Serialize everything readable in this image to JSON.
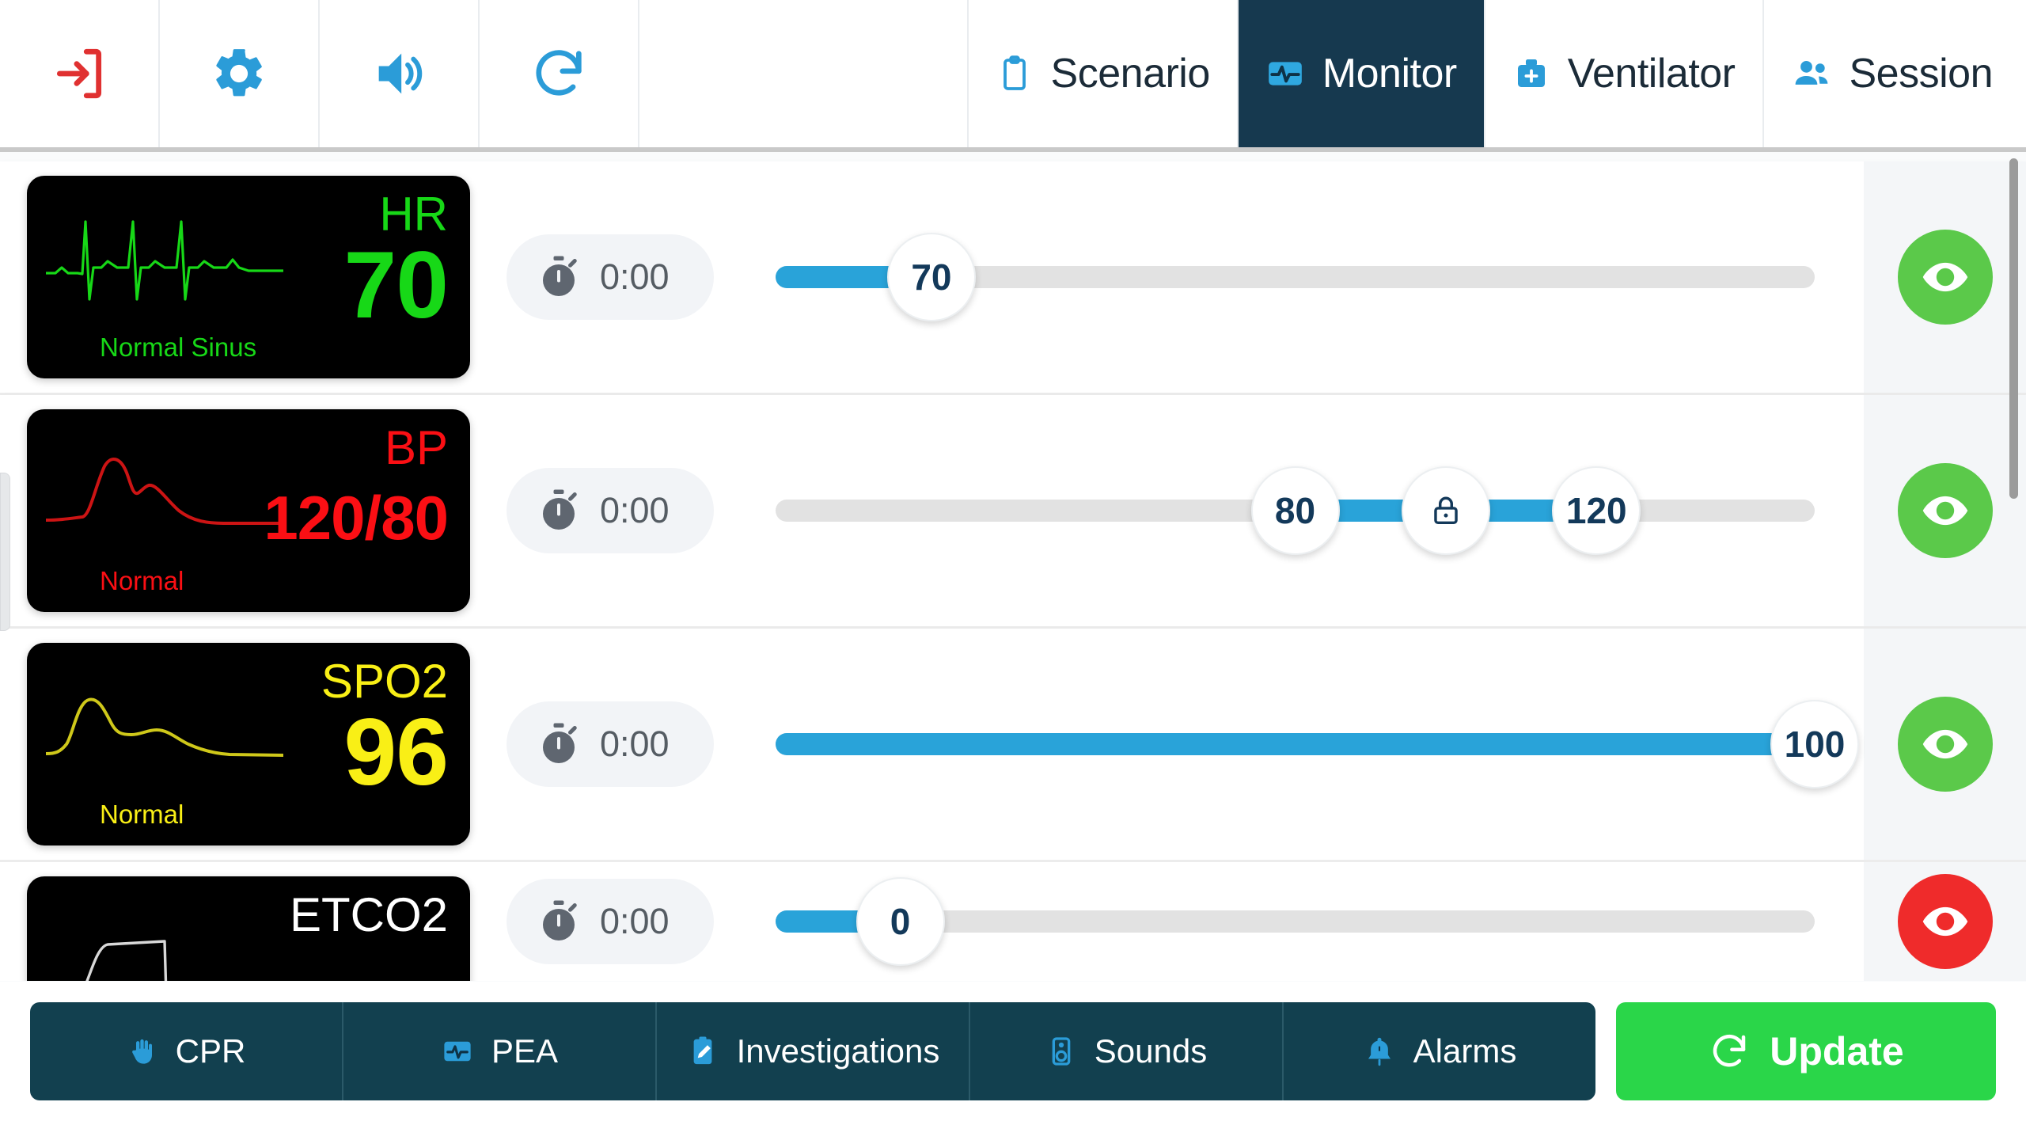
{
  "header": {
    "icon_buttons": [
      {
        "name": "exit-icon",
        "color": "#e03131"
      },
      {
        "name": "settings-gear-icon",
        "color": "#2b9cd8"
      },
      {
        "name": "volume-icon",
        "color": "#2b9cd8"
      },
      {
        "name": "refresh-icon",
        "color": "#2b9cd8"
      }
    ],
    "tabs": [
      {
        "label": "Scenario",
        "icon": "clipboard-icon",
        "active": false
      },
      {
        "label": "Monitor",
        "icon": "monitor-waveform-icon",
        "active": true
      },
      {
        "label": "Ventilator",
        "icon": "medical-bag-icon",
        "active": false
      },
      {
        "label": "Session",
        "icon": "people-icon",
        "active": false
      }
    ]
  },
  "vitals": [
    {
      "label": "HR",
      "value": "70",
      "status": "Normal Sinus",
      "color": "#17d817",
      "waveform": "ecg",
      "timer": "0:00",
      "slider": {
        "type": "single",
        "value": 70,
        "min": 0,
        "max": 250,
        "fill_pct": 15
      },
      "visibility": {
        "icon": "eye-icon",
        "state": "visible",
        "color": "#5bc94a"
      }
    },
    {
      "label": "BP",
      "value": "120/80",
      "status": "Normal",
      "color": "#fb0f14",
      "waveform": "arterial",
      "timer": "0:00",
      "slider": {
        "type": "range",
        "low": 80,
        "high": 120,
        "lock": true,
        "min": 0,
        "max": 250,
        "low_pct": 50,
        "high_pct": 79
      },
      "visibility": {
        "icon": "eye-icon",
        "state": "visible",
        "color": "#5bc94a"
      }
    },
    {
      "label": "SPO2",
      "value": "96",
      "status": "Normal",
      "color": "#f9ef16",
      "waveform": "pleth",
      "timer": "0:00",
      "slider": {
        "type": "single",
        "value": 100,
        "min": 0,
        "max": 100,
        "fill_pct": 100
      },
      "visibility": {
        "icon": "eye-icon",
        "state": "visible",
        "color": "#5bc94a"
      }
    },
    {
      "label": "ETCO2",
      "value": "",
      "status": "",
      "color": "#ffffff",
      "waveform": "capno",
      "timer": "0:00",
      "slider": {
        "type": "single",
        "value": 0,
        "min": 0,
        "max": 100,
        "fill_pct": 12
      },
      "visibility": {
        "icon": "eye-slash-icon",
        "state": "hidden",
        "color": "#ef2b2b"
      }
    }
  ],
  "footer": {
    "buttons": [
      {
        "label": "CPR",
        "icon": "hand-icon"
      },
      {
        "label": "PEA",
        "icon": "monitor-waveform-icon"
      },
      {
        "label": "Investigations",
        "icon": "clipboard-pencil-icon"
      },
      {
        "label": "Sounds",
        "icon": "speaker-icon"
      },
      {
        "label": "Alarms",
        "icon": "bell-icon"
      }
    ],
    "update": {
      "label": "Update",
      "icon": "refresh-icon",
      "color": "#2ad649"
    }
  },
  "colors": {
    "accent_blue": "#29a3d9",
    "nav_active": "#16394f",
    "footer_bar": "#12404f",
    "update_green": "#2ad649",
    "eye_green": "#5bc94a",
    "eye_red": "#ef2b2b",
    "thumb_text": "#13395a"
  }
}
